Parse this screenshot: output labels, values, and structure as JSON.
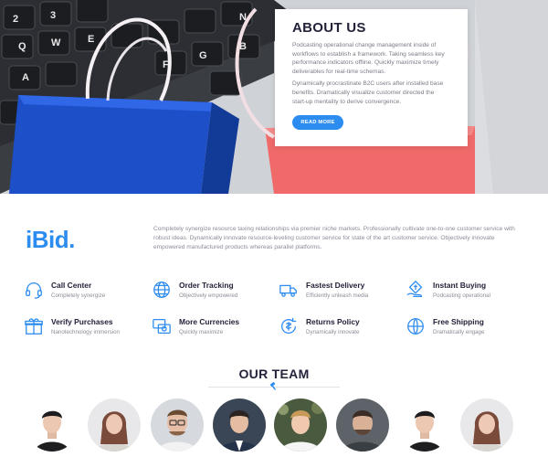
{
  "about": {
    "title": "ABOUT US",
    "paragraph1": "Podcasting operational change management inside of workflows to establish a framework. Taking seamless key performance indicators offline. Quickly maximize timely deliverables for real-time schemas.",
    "paragraph2": "Dynamically procrastinate B2C users after installed base benefits. Dramatically visualize customer directed the start-up mentality to derive convergence.",
    "button": "READ MORE"
  },
  "brand": {
    "logo": "iBid",
    "logo_dot": ".",
    "description": "Completely synergize resource taxing relationships via premier niche markets. Professionally cultivate one-to-one customer service with robust ideas. Dynamically innovate resource-leveling customer service for state of the art customer service. Objectively innovate empowered manufactured products whereas parallel platforms."
  },
  "features": [
    {
      "title": "Call Center",
      "subtitle": "Completely synergize",
      "icon": "headset-icon"
    },
    {
      "title": "Order Tracking",
      "subtitle": "Objectively empowered",
      "icon": "globe-tracking-icon"
    },
    {
      "title": "Fastest Delivery",
      "subtitle": "Efficiently unleash media",
      "icon": "truck-icon"
    },
    {
      "title": "Instant Buying",
      "subtitle": "Podcasting operational",
      "icon": "hand-coin-icon"
    },
    {
      "title": "Verify Purchases",
      "subtitle": "Nanotechnology immersion",
      "icon": "gift-box-icon"
    },
    {
      "title": "More Currencies",
      "subtitle": "Quickly maximize",
      "icon": "currency-exchange-icon"
    },
    {
      "title": "Returns Policy",
      "subtitle": "Dynamically innovate",
      "icon": "return-icon"
    },
    {
      "title": "Free Shipping",
      "subtitle": "Dramatically engage",
      "icon": "world-shipping-icon"
    }
  ],
  "team": {
    "title": "OUR TEAM",
    "members": [
      {
        "icon": "member-avatar-icon"
      },
      {
        "icon": "member-avatar-icon"
      },
      {
        "icon": "member-avatar-icon"
      },
      {
        "icon": "member-avatar-icon"
      },
      {
        "icon": "member-avatar-icon"
      },
      {
        "icon": "member-avatar-icon"
      },
      {
        "icon": "member-avatar-icon"
      },
      {
        "icon": "member-avatar-icon"
      }
    ]
  },
  "colors": {
    "accent": "#2d8cf0",
    "heading": "#22223a",
    "muted": "#8a8d97"
  }
}
